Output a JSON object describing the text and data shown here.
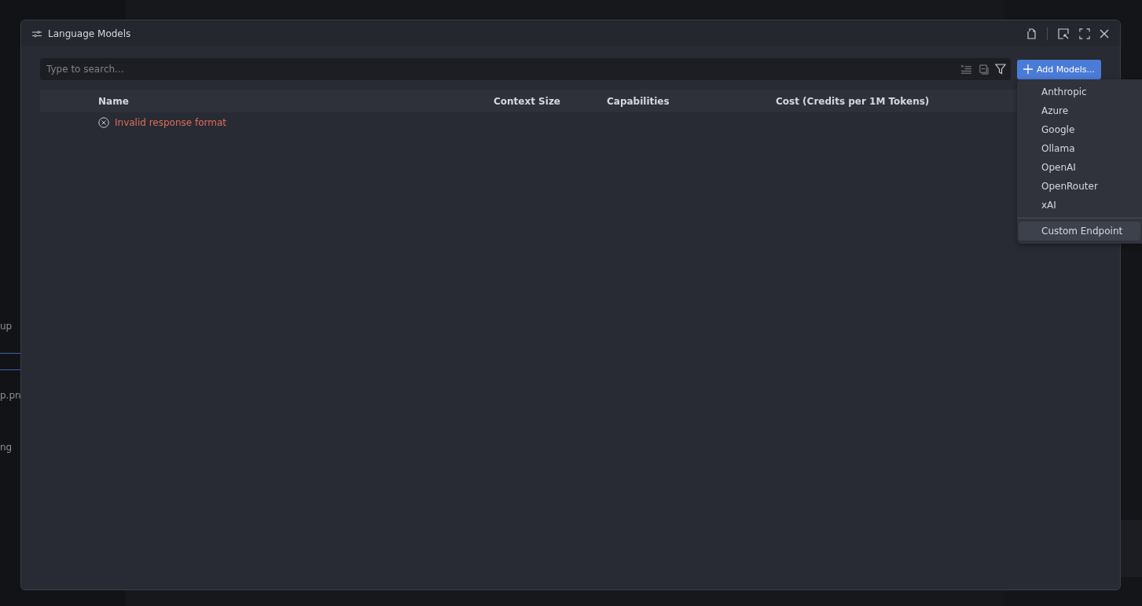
{
  "background": {
    "sidebar_fragments": [
      "up",
      "p.pn",
      "ng"
    ]
  },
  "window": {
    "title": "Language Models"
  },
  "search": {
    "placeholder": "Type to search..."
  },
  "add_button": {
    "label": "Add Models..."
  },
  "table": {
    "columns": [
      "Name",
      "Context Size",
      "Capabilities",
      "Cost (Credits per 1M Tokens)"
    ],
    "error": "Invalid response format"
  },
  "menu": {
    "items": [
      {
        "label": "Anthropic",
        "kind": "item",
        "selected": false
      },
      {
        "label": "Azure",
        "kind": "item",
        "selected": false
      },
      {
        "label": "Google",
        "kind": "item",
        "selected": false
      },
      {
        "label": "Ollama",
        "kind": "item",
        "selected": false
      },
      {
        "label": "OpenAI",
        "kind": "item",
        "selected": false
      },
      {
        "label": "OpenRouter",
        "kind": "item",
        "selected": false
      },
      {
        "label": "xAI",
        "kind": "item",
        "selected": false
      },
      {
        "kind": "separator"
      },
      {
        "label": "Custom Endpoint",
        "kind": "item",
        "selected": true
      }
    ]
  }
}
